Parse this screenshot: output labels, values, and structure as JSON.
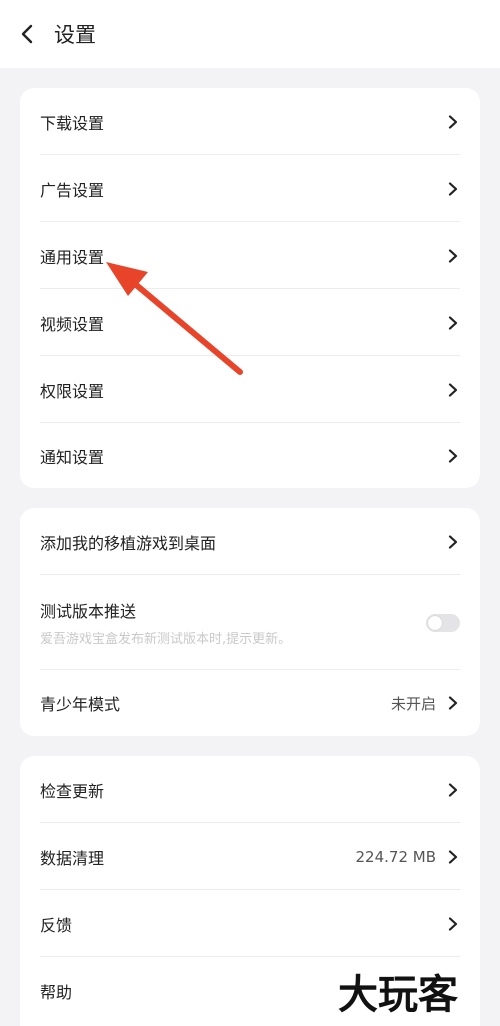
{
  "header": {
    "title": "设置"
  },
  "group1": [
    {
      "label": "下载设置"
    },
    {
      "label": "广告设置"
    },
    {
      "label": "通用设置"
    },
    {
      "label": "视频设置"
    },
    {
      "label": "权限设置"
    },
    {
      "label": "通知设置"
    }
  ],
  "group2": {
    "add_to_desktop": {
      "label": "添加我的移植游戏到桌面"
    },
    "beta_push": {
      "label": "测试版本推送",
      "sub": "爱吾游戏宝盒发布新测试版本时,提示更新。",
      "enabled": false
    },
    "youth_mode": {
      "label": "青少年模式",
      "value": "未开启"
    }
  },
  "group3": {
    "check_update": {
      "label": "检查更新"
    },
    "data_clean": {
      "label": "数据清理",
      "value": "224.72 MB"
    },
    "feedback": {
      "label": "反馈"
    },
    "help": {
      "label": "帮助"
    }
  },
  "watermark": "大玩客",
  "colors": {
    "annotation_arrow": "#e8442a",
    "background": "#f3f3f5",
    "card": "#ffffff"
  }
}
